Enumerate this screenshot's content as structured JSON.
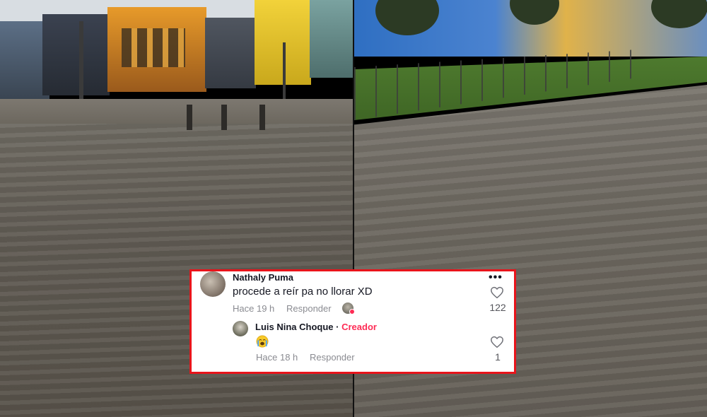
{
  "comment": {
    "username": "Nathaly Puma",
    "text": "procede a reír pa no llorar XD",
    "time": "Hace 19 h",
    "reply_label": "Responder",
    "like_count": "122",
    "more_label": "•••",
    "avatar_icon": "user-avatar"
  },
  "reply": {
    "username": "Luis Nina Choque",
    "separator": "·",
    "badge": "Creador",
    "emoji_icon": "crying-face-emoji",
    "time": "Hace 18 h",
    "reply_label": "Responder",
    "like_count": "1",
    "avatar_icon": "user-avatar"
  },
  "colors": {
    "highlight_border": "#e8141b",
    "creator_badge": "#fe2c55",
    "meta_text": "#8a8b91"
  }
}
